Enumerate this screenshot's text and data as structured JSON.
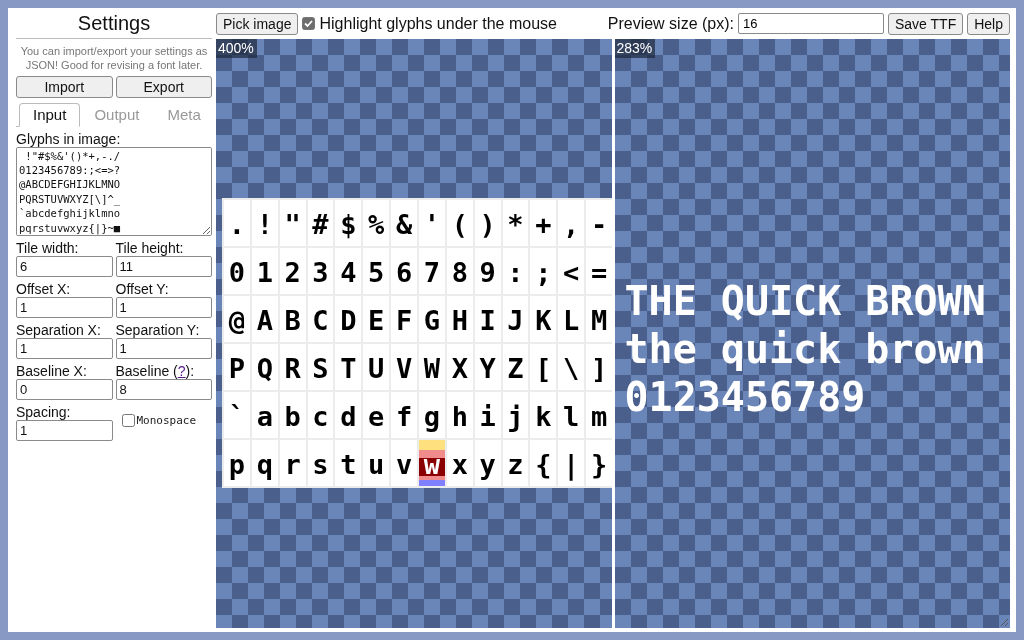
{
  "settings": {
    "title": "Settings",
    "note": "You can import/export your settings as JSON! Good for revising a font later.",
    "buttons": [
      "Import",
      "Export"
    ],
    "tabs": [
      {
        "label": "Input",
        "selected": true
      },
      {
        "label": "Output",
        "selected": false
      },
      {
        "label": "Meta",
        "selected": false
      }
    ],
    "glyphs_label": "Glyphs in image:",
    "glyphs_lines": [
      " !\"#$%&'()*+,-./",
      "0123456789:;<=>?",
      "@ABCDEFGHIJKLMNO",
      "PQRSTUVWXYZ[\\]^_",
      "`abcdefghijklmno",
      "pqrstuvwxyz{|}~■"
    ],
    "fields": [
      {
        "label": "Tile width:",
        "value": "6"
      },
      {
        "label": "Tile height:",
        "value": "11"
      },
      {
        "label": "Offset X:",
        "value": "1"
      },
      {
        "label": "Offset Y:",
        "value": "1"
      },
      {
        "label": "Separation X:",
        "value": "1"
      },
      {
        "label": "Separation Y:",
        "value": "1"
      },
      {
        "label": "Baseline X:",
        "value": "0"
      },
      {
        "label": "Baseline (",
        "help_link": "?",
        "label_after": "):",
        "value": "8"
      },
      {
        "label": "Spacing:",
        "value": "1"
      }
    ],
    "monospace": {
      "label": "Monospace",
      "checked": false
    }
  },
  "toolbar": {
    "pick_button": "Pick image",
    "highlight": {
      "label": "Highlight glyphs under the mouse",
      "checked": true
    },
    "preview_label": "Preview size (px):",
    "preview_value": "16",
    "buttons": [
      "Save TTF",
      "Help"
    ]
  },
  "source_view": {
    "zoom": "400%",
    "glyph_rows": [
      [
        {
          "char": ".",
          "highlighted": false
        },
        {
          "char": "!",
          "highlighted": false
        },
        {
          "char": "\"",
          "highlighted": false
        },
        {
          "char": "#",
          "highlighted": false
        },
        {
          "char": "$",
          "highlighted": false
        },
        {
          "char": "%",
          "highlighted": false
        },
        {
          "char": "&",
          "highlighted": false
        },
        {
          "char": "'",
          "highlighted": false
        },
        {
          "char": "(",
          "highlighted": false
        },
        {
          "char": ")",
          "highlighted": false
        },
        {
          "char": "*",
          "highlighted": false
        },
        {
          "char": "+",
          "highlighted": false
        },
        {
          "char": ",",
          "highlighted": false
        },
        {
          "char": "-",
          "highlighted": false
        }
      ],
      [
        {
          "char": "0",
          "highlighted": false
        },
        {
          "char": "1",
          "highlighted": false
        },
        {
          "char": "2",
          "highlighted": false
        },
        {
          "char": "3",
          "highlighted": false
        },
        {
          "char": "4",
          "highlighted": false
        },
        {
          "char": "5",
          "highlighted": false
        },
        {
          "char": "6",
          "highlighted": false
        },
        {
          "char": "7",
          "highlighted": false
        },
        {
          "char": "8",
          "highlighted": false
        },
        {
          "char": "9",
          "highlighted": false
        },
        {
          "char": ":",
          "highlighted": false
        },
        {
          "char": ";",
          "highlighted": false
        },
        {
          "char": "<",
          "highlighted": false
        },
        {
          "char": "=",
          "highlighted": false
        }
      ],
      [
        {
          "char": "@",
          "highlighted": false
        },
        {
          "char": "A",
          "highlighted": false
        },
        {
          "char": "B",
          "highlighted": false
        },
        {
          "char": "C",
          "highlighted": false
        },
        {
          "char": "D",
          "highlighted": false
        },
        {
          "char": "E",
          "highlighted": false
        },
        {
          "char": "F",
          "highlighted": false
        },
        {
          "char": "G",
          "highlighted": false
        },
        {
          "char": "H",
          "highlighted": false
        },
        {
          "char": "I",
          "highlighted": false
        },
        {
          "char": "J",
          "highlighted": false
        },
        {
          "char": "K",
          "highlighted": false
        },
        {
          "char": "L",
          "highlighted": false
        },
        {
          "char": "M",
          "highlighted": false
        }
      ],
      [
        {
          "char": "P",
          "highlighted": false
        },
        {
          "char": "Q",
          "highlighted": false
        },
        {
          "char": "R",
          "highlighted": false
        },
        {
          "char": "S",
          "highlighted": false
        },
        {
          "char": "T",
          "highlighted": false
        },
        {
          "char": "U",
          "highlighted": false
        },
        {
          "char": "V",
          "highlighted": false
        },
        {
          "char": "W",
          "highlighted": false
        },
        {
          "char": "X",
          "highlighted": false
        },
        {
          "char": "Y",
          "highlighted": false
        },
        {
          "char": "Z",
          "highlighted": false
        },
        {
          "char": "[",
          "highlighted": false
        },
        {
          "char": "\\",
          "highlighted": false
        },
        {
          "char": "]",
          "highlighted": false
        }
      ],
      [
        {
          "char": "`",
          "highlighted": false
        },
        {
          "char": "a",
          "highlighted": false
        },
        {
          "char": "b",
          "highlighted": false
        },
        {
          "char": "c",
          "highlighted": false
        },
        {
          "char": "d",
          "highlighted": false
        },
        {
          "char": "e",
          "highlighted": false
        },
        {
          "char": "f",
          "highlighted": false
        },
        {
          "char": "g",
          "highlighted": false
        },
        {
          "char": "h",
          "highlighted": false
        },
        {
          "char": "i",
          "highlighted": false
        },
        {
          "char": "j",
          "highlighted": false
        },
        {
          "char": "k",
          "highlighted": false
        },
        {
          "char": "l",
          "highlighted": false
        },
        {
          "char": "m",
          "highlighted": false
        }
      ],
      [
        {
          "char": "p",
          "highlighted": false
        },
        {
          "char": "q",
          "highlighted": false
        },
        {
          "char": "r",
          "highlighted": false
        },
        {
          "char": "s",
          "highlighted": false
        },
        {
          "char": "t",
          "highlighted": false
        },
        {
          "char": "u",
          "highlighted": false
        },
        {
          "char": "v",
          "highlighted": false
        },
        {
          "char": "w",
          "highlighted": true
        },
        {
          "char": "x",
          "highlighted": false
        },
        {
          "char": "y",
          "highlighted": false
        },
        {
          "char": "z",
          "highlighted": false
        },
        {
          "char": "{",
          "highlighted": false
        },
        {
          "char": "|",
          "highlighted": false
        },
        {
          "char": "}",
          "highlighted": false
        }
      ]
    ]
  },
  "preview_view": {
    "zoom": "283%",
    "lines": [
      "THE QUICK BROWN",
      "the quick brown",
      "0123456789"
    ]
  }
}
